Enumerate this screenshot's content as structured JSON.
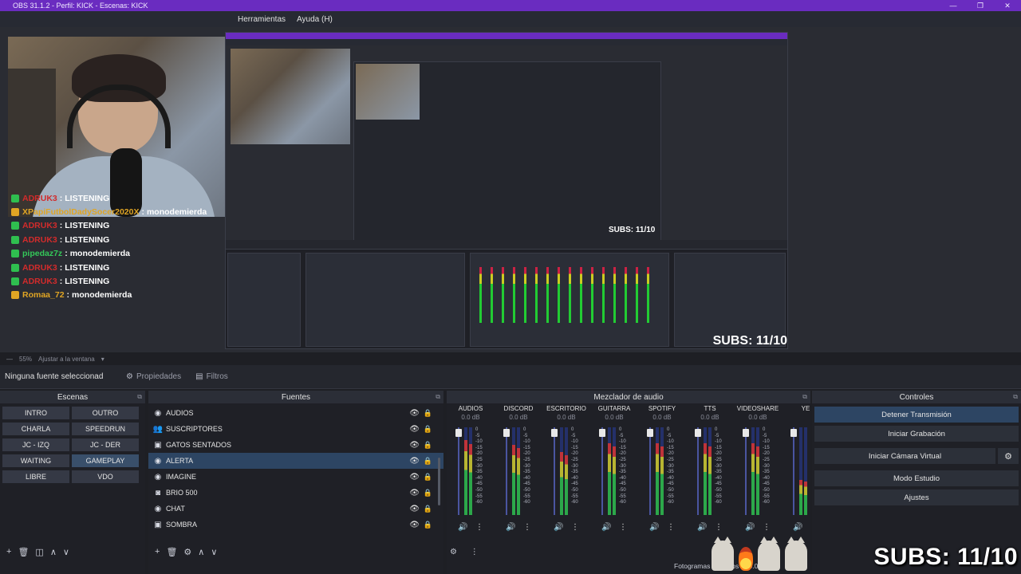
{
  "window": {
    "title": "OBS 31.1.2 - Perfil: KICK - Escenas: KICK",
    "min": "—",
    "max": "❐",
    "close": "✕"
  },
  "menu": [
    "Herramientas",
    "Ayuda (H)"
  ],
  "chat": [
    {
      "user": "ADRUK3",
      "msg": "LISTENING",
      "color": "#d22b2b"
    },
    {
      "user": "XPapiFutbolDadySocer2020X",
      "msg": "monodemierda",
      "color": "#e0a524"
    },
    {
      "user": "ADRUK3",
      "msg": "LISTENING",
      "color": "#d22b2b"
    },
    {
      "user": "ADRUK3",
      "msg": "LISTENING",
      "color": "#d22b2b"
    },
    {
      "user": "pipedaz7z",
      "msg": "monodemierda",
      "color": "#34c759"
    },
    {
      "user": "ADRUK3",
      "msg": "LISTENING",
      "color": "#d22b2b"
    },
    {
      "user": "ADRUK3",
      "msg": "LISTENING",
      "color": "#d22b2b"
    },
    {
      "user": "Romaa_72",
      "msg": "monodemierda",
      "color": "#e0a524"
    }
  ],
  "zoom": {
    "value": "55%",
    "fit": "Ajustar a la ventana"
  },
  "source_bar": {
    "none_selected": "Ninguna fuente seleccionad",
    "properties": "Propiedades",
    "filters": "Filtros"
  },
  "scenes": {
    "title": "Escenas",
    "items": [
      "INTRO",
      "OUTRO",
      "CHARLA",
      "SPEEDRUN",
      "JC - IZQ",
      "JC - DER",
      "WAITING",
      "GAMEPLAY",
      "LIBRE",
      "VDO"
    ],
    "active": "GAMEPLAY"
  },
  "sources": {
    "title": "Fuentes",
    "items": [
      {
        "name": "AUDIOS",
        "icon": "globe-icon"
      },
      {
        "name": "SUSCRIPTORES",
        "icon": "users-icon"
      },
      {
        "name": "GATOS SENTADOS",
        "icon": "image-icon"
      },
      {
        "name": "ALERTA",
        "icon": "globe-icon"
      },
      {
        "name": "IMAGINE",
        "icon": "globe-icon"
      },
      {
        "name": "BRIO 500",
        "icon": "camera-icon"
      },
      {
        "name": "CHAT",
        "icon": "globe-icon"
      },
      {
        "name": "SOMBRA",
        "icon": "image-icon"
      }
    ],
    "selected": "ALERTA"
  },
  "mixer": {
    "title": "Mezclador de audio",
    "channels": [
      {
        "name": "AUDIOS",
        "db": "0.0 dB",
        "level": 0.85
      },
      {
        "name": "DISCORD",
        "db": "0.0 dB",
        "level": 0.8
      },
      {
        "name": "ESCRITORIO",
        "db": "0.0 dB",
        "level": 0.72
      },
      {
        "name": "GUITARRA",
        "db": "0.0 dB",
        "level": 0.82
      },
      {
        "name": "SPOTIFY",
        "db": "0.0 dB",
        "level": 0.82
      },
      {
        "name": "TTS",
        "db": "0.0 dB",
        "level": 0.82
      },
      {
        "name": "VIDEOSHARE",
        "db": "0.0 dB",
        "level": 0.82
      },
      {
        "name": "YE",
        "db": "",
        "level": 0.4
      }
    ],
    "ticks": [
      "0",
      "-5",
      "-10",
      "-15",
      "-20",
      "-25",
      "-30",
      "-35",
      "-40",
      "-45",
      "-50",
      "-55",
      "-60"
    ]
  },
  "controls": {
    "title": "Controles",
    "stop_stream": "Detener Transmisión",
    "start_record": "Iniciar Grabación",
    "virtual_cam": "Iniciar Cámara Virtual",
    "studio_mode": "Modo Estudio",
    "settings": "Ajustes"
  },
  "status": {
    "dropped": "Fotogramas Perdidos 0 (0.0%)"
  },
  "subs": "SUBS: 11/10",
  "nested": {
    "subs_small": "SUBS: 11/10",
    "subs_mid": "SUBS: 11/10"
  }
}
